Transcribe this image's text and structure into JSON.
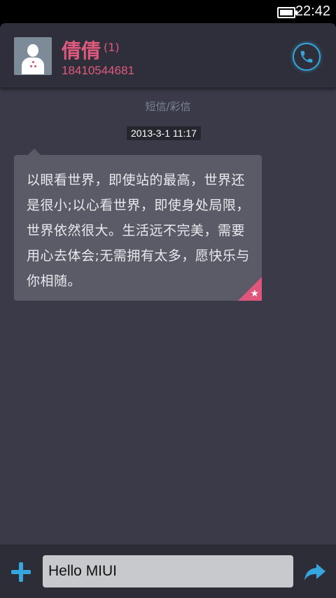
{
  "status_bar": {
    "time": "22:42",
    "battery_icon": "battery-icon"
  },
  "header": {
    "contact_name": "倩倩",
    "unread_count": "(1)",
    "phone_number": "18410544681",
    "avatar_icon": "person-avatar-icon",
    "call_icon": "phone-icon"
  },
  "thread": {
    "message_type": "短信/彩信",
    "timestamp": "2013-3-1 11:17",
    "message_text": "以眼看世界，即使站的最高，世界还是很小;以心看世界，即使身处局限，世界依然很大。生活远不完美，需要用心去体会;无需拥有太多，愿快乐与你相随。",
    "star_icon": "★"
  },
  "compose": {
    "add_icon": "plus-icon",
    "input_value": "Hello MIUI",
    "send_icon": "send-arrow-icon"
  },
  "colors": {
    "accent_pink": "#e05a7e",
    "accent_blue": "#35a7de",
    "background": "#3a3a48"
  }
}
